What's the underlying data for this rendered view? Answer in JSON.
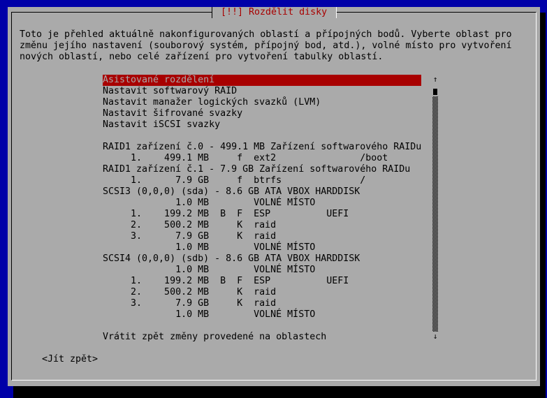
{
  "dialog": {
    "title": "[!!] Rozdělit disky",
    "intro": [
      "Toto je přehled aktuálně nakonfigurovaných oblastí a přípojných bodů. Vyberte oblast pro",
      "změnu jejího nastavení (souborový systém, přípojný bod, atd.), volné místo pro vytvoření",
      "nových oblastí, nebo celé zařízení pro vytvoření tabulky oblastí."
    ],
    "menu": [
      "Asistované rozdělení",
      "Nastavit softwarový RAID",
      "Nastavit manažer logických svazků (LVM)",
      "Nastavit šifrované svazky",
      "Nastavit iSCSI svazky",
      "",
      "RAID1 zařízení č.0 - 499.1 MB Zařízení softwarového RAIDu",
      "     1.    499.1 MB     f  ext2               /boot",
      "RAID1 zařízení č.1 - 7.9 GB Zařízení softwarového RAIDu",
      "     1.      7.9 GB     f  btrfs              /",
      "SCSI3 (0,0,0) (sda) - 8.6 GB ATA VBOX HARDDISK",
      "             1.0 MB        VOLNÉ MÍSTO",
      "     1.    199.2 MB  B  F  ESP          UEFI",
      "     2.    500.2 MB     K  raid",
      "     3.      7.9 GB     K  raid",
      "             1.0 MB        VOLNÉ MÍSTO",
      "SCSI4 (0,0,0) (sdb) - 8.6 GB ATA VBOX HARDDISK",
      "             1.0 MB        VOLNÉ MÍSTO",
      "     1.    199.2 MB  B  F  ESP          UEFI",
      "     2.    500.2 MB     K  raid",
      "     3.      7.9 GB     K  raid",
      "             1.0 MB        VOLNÉ MÍSTO",
      "",
      "Vrátit zpět změny provedené na oblastech"
    ],
    "selected_index": 0,
    "scroll_up": "↑",
    "scroll_down": "↓",
    "back_button": "<Jít zpět>"
  },
  "colors": {
    "background": "#0000a8",
    "dialog": "#aaaaaa",
    "highlight": "#a80000",
    "title": "#a80000"
  }
}
